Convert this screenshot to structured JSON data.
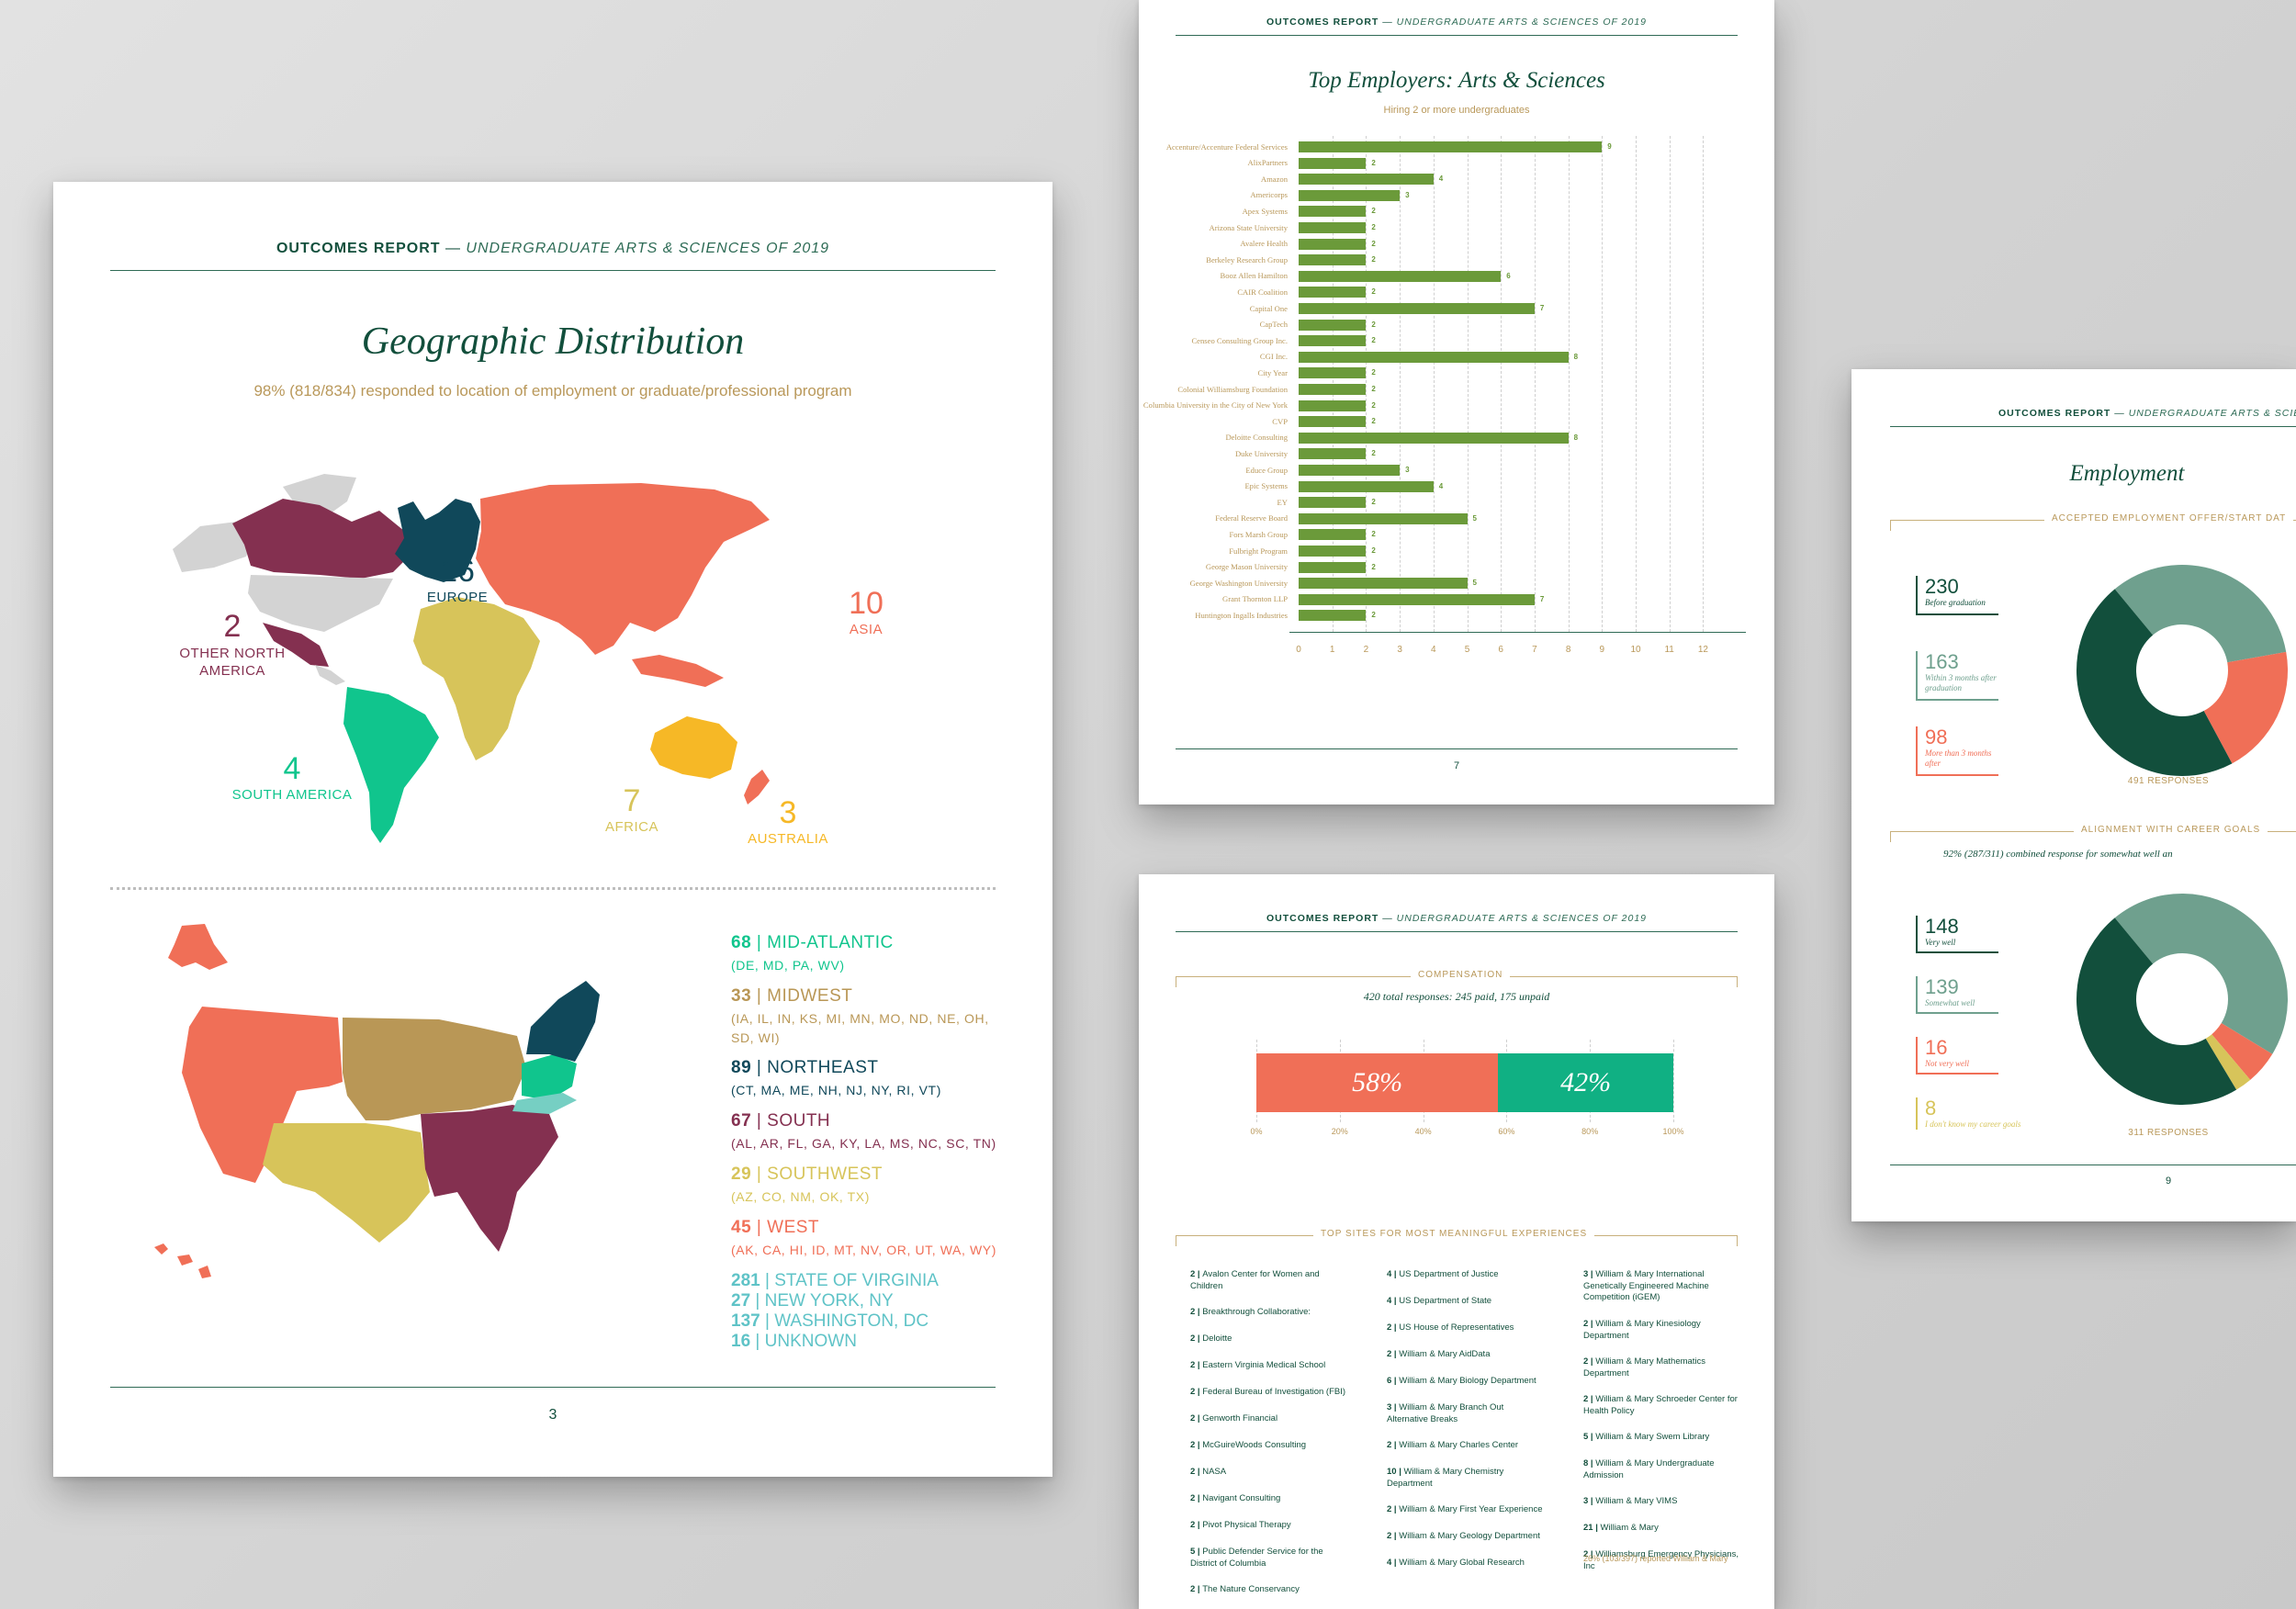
{
  "colors": {
    "green_dark": "#124f3c",
    "tan": "#b9985a",
    "maroon": "#843050",
    "coral": "#f06f57",
    "mustard": "#d7c45a",
    "teal_green": "#10c58d",
    "navy": "#10485a",
    "gold": "#f6b826",
    "light_teal": "#76cfc3",
    "khaki": "#b99756",
    "bar_green": "#6b9a3a"
  },
  "header": {
    "bold": "OUTCOMES REPORT",
    "dash": "—",
    "italic": "UNDERGRADUATE ARTS & SCIENCES OF 2019"
  },
  "page3": {
    "title": "Geographic Distribution",
    "subtitle": "98% (818/834) responded to location of employment or graduate/professional program",
    "world": [
      {
        "num": "2",
        "name": "OTHER NORTH AMERICA",
        "color": "#843050"
      },
      {
        "num": "16",
        "name": "EUROPE",
        "color": "#10485a"
      },
      {
        "num": "10",
        "name": "ASIA",
        "color": "#f06f57"
      },
      {
        "num": "4",
        "name": "SOUTH AMERICA",
        "color": "#10c58d"
      },
      {
        "num": "7",
        "name": "AFRICA",
        "color": "#d7c45a"
      },
      {
        "num": "3",
        "name": "AUSTRALIA",
        "color": "#f6b826"
      }
    ],
    "us_regions": [
      {
        "num": "68",
        "name": "MID-ATLANTIC",
        "states": "(DE, MD, PA, WV)",
        "color": "#10c58d"
      },
      {
        "num": "33",
        "name": "MIDWEST",
        "states": "(IA, IL, IN, KS, MI, MN, MO, ND, NE, OH, SD, WI)",
        "color": "#b99756"
      },
      {
        "num": "89",
        "name": "NORTHEAST",
        "states": "(CT, MA, ME, NH, NJ, NY, RI, VT)",
        "color": "#10485a"
      },
      {
        "num": "67",
        "name": "SOUTH",
        "states": "(AL, AR, FL, GA, KY, LA, MS, NC, SC, TN)",
        "color": "#843050"
      },
      {
        "num": "29",
        "name": "SOUTHWEST",
        "states": "(AZ, CO, NM, OK, TX)",
        "color": "#d7c45a"
      },
      {
        "num": "45",
        "name": "WEST",
        "states": "(AK, CA, HI, ID, MT, NV, OR, UT, WA, WY)",
        "color": "#f06f57"
      }
    ],
    "other_locs": [
      {
        "num": "281",
        "name": "STATE OF VIRGINIA"
      },
      {
        "num": "27",
        "name": "NEW YORK, NY"
      },
      {
        "num": "137",
        "name": "WASHINGTON, DC"
      },
      {
        "num": "16",
        "name": "UNKNOWN"
      }
    ],
    "page_num": "3"
  },
  "page7": {
    "title": "Top Employers: Arts & Sciences",
    "subtitle": "Hiring 2 or more undergraduates",
    "page_num": "7"
  },
  "chart_data": {
    "type": "bar",
    "orientation": "horizontal",
    "title": "Top Employers: Arts & Sciences",
    "subtitle": "Hiring 2 or more undergraduates",
    "xlim": [
      0,
      12
    ],
    "xticks": [
      "0",
      "1",
      "2",
      "3",
      "4",
      "5",
      "6",
      "7",
      "8",
      "9",
      "10",
      "11",
      "12"
    ],
    "categories": [
      "Accenture/Accenture Federal Services",
      "AlixPartners",
      "Amazon",
      "Americorps",
      "Apex Systems",
      "Arizona State University",
      "Avalere Health",
      "Berkeley Research Group",
      "Booz Allen Hamilton",
      "CAIR Coalition",
      "Capital One",
      "CapTech",
      "Censeo Consulting Group Inc.",
      "CGI Inc.",
      "City Year",
      "Colonial Williamsburg Foundation",
      "Columbia University in the City of New York",
      "CVP",
      "Deloitte Consulting",
      "Duke University",
      "Educe Group",
      "Epic Systems",
      "EY",
      "Federal Reserve Board",
      "Fors Marsh Group",
      "Fulbright Program",
      "George Mason University",
      "George Washington University",
      "Grant Thornton LLP",
      "Huntington Ingalls Industries"
    ],
    "values": [
      9,
      2,
      4,
      3,
      2,
      2,
      2,
      2,
      6,
      2,
      7,
      2,
      2,
      8,
      2,
      2,
      2,
      2,
      8,
      2,
      3,
      4,
      2,
      5,
      2,
      2,
      2,
      5,
      7,
      2
    ],
    "value_labels": [
      "9",
      "2",
      "4",
      "3",
      "2",
      "2",
      "2",
      "2",
      "6",
      "2",
      "7",
      "2",
      "2",
      "8",
      "2",
      "2",
      "2",
      "2",
      "8",
      "2",
      "3",
      "4",
      "2",
      "5",
      "2",
      "2",
      "2",
      "5",
      "7",
      "2"
    ]
  },
  "page_comp": {
    "section": "COMPENSATION",
    "subtitle": "420 total responses: 245 paid, 175 unpaid",
    "paid_pct": "58%",
    "unpaid_pct": "42%",
    "paid_frac": 0.58,
    "axis": [
      "0%",
      "20%",
      "40%",
      "60%",
      "80%",
      "100%"
    ],
    "sites_title": "TOP SITES FOR MOST MEANINGFUL EXPERIENCES",
    "sites_col1": [
      {
        "n": "2 |",
        "t": "Avalon Center for Women and Children"
      },
      {
        "n": "2 |",
        "t": "Breakthrough Collaborative:"
      },
      {
        "n": "2 |",
        "t": "Deloitte"
      },
      {
        "n": "2 |",
        "t": "Eastern Virginia Medical School"
      },
      {
        "n": "2 |",
        "t": "Federal Bureau of Investigation (FBI)"
      },
      {
        "n": "2 |",
        "t": "Genworth Financial"
      },
      {
        "n": "2 |",
        "t": "McGuireWoods Consulting"
      },
      {
        "n": "2 |",
        "t": "NASA"
      },
      {
        "n": "2 |",
        "t": "Navigant Consulting"
      },
      {
        "n": "2 |",
        "t": "Pivot Physical Therapy"
      },
      {
        "n": "5 |",
        "t": "Public Defender Service for the District of Columbia"
      },
      {
        "n": "2 |",
        "t": "The Nature Conservancy"
      }
    ],
    "sites_col2": [
      {
        "n": "4 |",
        "t": "US Department of Justice"
      },
      {
        "n": "4 |",
        "t": "US Department of State"
      },
      {
        "n": "2 |",
        "t": "US House of Representatives"
      },
      {
        "n": "2 |",
        "t": "William & Mary AidData"
      },
      {
        "n": "6 |",
        "t": "William & Mary Biology Department"
      },
      {
        "n": "3 |",
        "t": "William & Mary Branch Out Alternative Breaks"
      },
      {
        "n": "2 |",
        "t": "William & Mary Charles Center"
      },
      {
        "n": "10 |",
        "t": "William & Mary Chemistry Department"
      },
      {
        "n": "2 |",
        "t": "William & Mary First Year Experience"
      },
      {
        "n": "2 |",
        "t": "William & Mary Geology Department"
      },
      {
        "n": "4 |",
        "t": "William & Mary Global Research"
      }
    ],
    "sites_col3": [
      {
        "n": "3 |",
        "t": "William & Mary International Genetically Engineered Machine Competition (iGEM)"
      },
      {
        "n": "2 |",
        "t": "William & Mary Kinesiology Department"
      },
      {
        "n": "2 |",
        "t": "William & Mary Mathematics Department"
      },
      {
        "n": "2 |",
        "t": "William & Mary Schroeder Center for Health Policy"
      },
      {
        "n": "5 |",
        "t": "William & Mary Swem Library"
      },
      {
        "n": "8 |",
        "t": "William & Mary Undergraduate Admission"
      },
      {
        "n": "3 |",
        "t": "William & Mary VIMS"
      },
      {
        "n": "21 |",
        "t": "William & Mary"
      },
      {
        "n": "2 |",
        "t": "Williamsburg Emergency Physicians, Inc"
      }
    ],
    "footnote": "26% (103/397) reported William & Mary"
  },
  "page9": {
    "title": "Employment",
    "section1": "ACCEPTED EMPLOYMENT OFFER/START DAT",
    "offer_stats": [
      {
        "n": "230",
        "l": "Before graduation",
        "color": "#124f3c"
      },
      {
        "n": "163",
        "l": "Within 3 months after graduation",
        "color": "#6fa08e"
      },
      {
        "n": "98",
        "l": "More than 3 months after",
        "color": "#f06f57"
      }
    ],
    "offer_responses": "491 RESPONSES",
    "section2": "ALIGNMENT WITH CAREER GOALS",
    "alignment_sub": "92% (287/311) combined response for somewhat well an",
    "align_stats": [
      {
        "n": "148",
        "l": "Very well",
        "color": "#124f3c"
      },
      {
        "n": "139",
        "l": "Somewhat well",
        "color": "#6fa08e"
      },
      {
        "n": "16",
        "l": "Not very well",
        "color": "#f06f57"
      },
      {
        "n": "8",
        "l": "I don't know my career goals",
        "color": "#d7c45a"
      }
    ],
    "align_responses": "311 RESPONSES",
    "page_num": "9"
  }
}
